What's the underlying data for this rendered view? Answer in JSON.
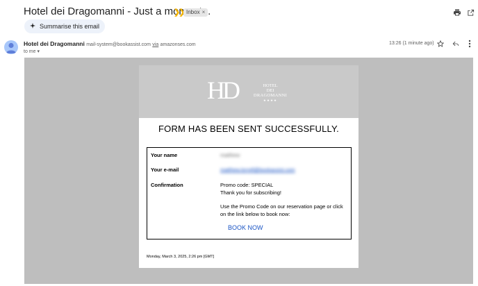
{
  "email": {
    "subject": "Hotel dei Dragomanni - Just a moment...",
    "label_badge": "Inbox",
    "label_close": "×",
    "summarise_label": "Summarise this email",
    "sender_name": "Hotel dei Dragomanni",
    "sender_email": "mail-system@bookassist.com",
    "via_label": "via",
    "via_domain": "amazonses.com",
    "to_label": "to me",
    "timestamp": "13:26 (1 minute ago)"
  },
  "body": {
    "logo_initials": "HD",
    "logo_name_line1": "HOTEL",
    "logo_name_line2": "DEI",
    "logo_name_line3": "DRAGOMANNI",
    "logo_stars": "★★★★",
    "form_title": "FORM HAS BEEN SENT SUCCESSFULLY.",
    "rows": {
      "name_label": "Your name",
      "name_value": "matthew",
      "email_label": "Your e-mail",
      "email_value": "matthew.lorrell@bookassist.com",
      "confirm_label": "Confirmation",
      "promo_line": "Promo code: SPECIAL",
      "thanks_line": "Thank you for subscribing!",
      "instructions": "Use the Promo Code on our reservation page or click on the link below to book now:"
    },
    "book_now": "BOOK NOW",
    "footer_date": "Monday, March 3, 2025, 2:26 pm [GMT]"
  },
  "icons": {
    "important": "important-marker-icon",
    "print": "print-icon",
    "popout": "open-in-new-window-icon",
    "sparkle": "sparkle-icon",
    "avatar": "avatar",
    "star": "star-icon",
    "reply": "reply-icon",
    "more": "more-vert-icon",
    "dropdown": "chevron-down-icon"
  }
}
